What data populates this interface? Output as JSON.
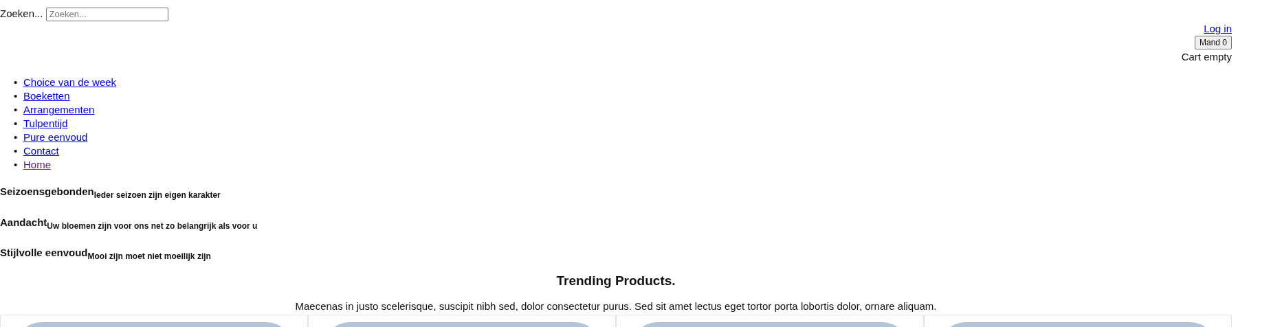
{
  "search": {
    "label": "Zoeken...",
    "placeholder": "Zoeken..."
  },
  "account": {
    "login": "Log in",
    "cart_button": "Mand 0",
    "cart_status": "Cart empty"
  },
  "nav": [
    {
      "marker": "•",
      "label": "Choice van de week",
      "visited": false
    },
    {
      "marker": "•",
      "label": "Boeketten",
      "visited": false
    },
    {
      "marker": "•",
      "label": "Arrangementen",
      "visited": false
    },
    {
      "marker": "•",
      "label": "Tulpentijd",
      "visited": false
    },
    {
      "marker": "•",
      "label": "Pure eenvoud",
      "visited": false
    },
    {
      "marker": "•",
      "label": "Contact",
      "visited": false
    },
    {
      "marker": "•",
      "label": "Home",
      "visited": true
    }
  ],
  "features": [
    {
      "title": "Seizoensgebonden",
      "subtitle": "Ieder seizoen zijn eigen karakter"
    },
    {
      "title": "Aandacht",
      "subtitle": "Uw bloemen zijn voor ons net zo belangrijk als voor u"
    },
    {
      "title": "Stijlvolle eenvoud",
      "subtitle": "Mooi zijn moet niet moeilijk zijn"
    }
  ],
  "trending": {
    "title": "Trending Products.",
    "text": "Maecenas in justo scelerisque, suscipit nibh sed, dolor consectetur purus. Sed sit amet lectus eget tortor porta lobortis dolor, ornare aliquam."
  },
  "products": [
    {
      "kind": "photo"
    },
    {
      "kind": "photo"
    },
    {
      "kind": "photo"
    },
    {
      "kind": "photo"
    }
  ]
}
